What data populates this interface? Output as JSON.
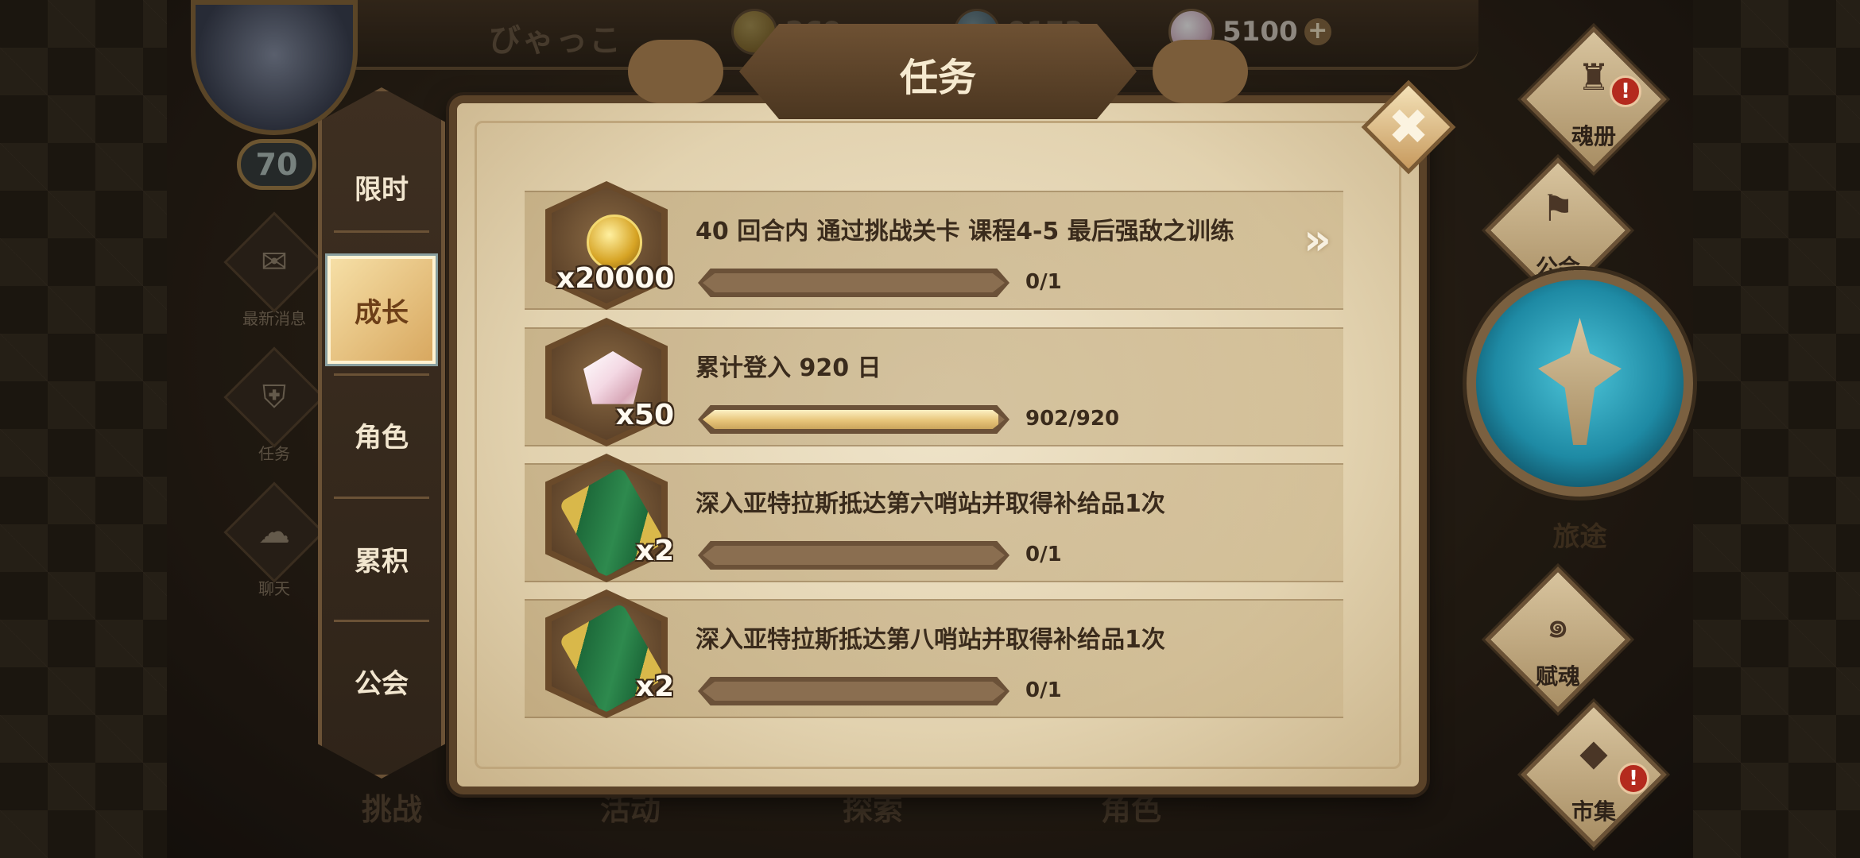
{
  "header": {
    "player_name": "びゃっこ",
    "level": "70",
    "currencies": [
      {
        "name": "gold",
        "value": "269"
      },
      {
        "name": "blue",
        "value": "9173"
      },
      {
        "name": "gem",
        "value": "5100"
      }
    ],
    "add_label": "+"
  },
  "left_menu": [
    {
      "label": "最新消息",
      "icon": "scroll-icon",
      "glyph": "✉"
    },
    {
      "label": "任务",
      "icon": "badge-icon",
      "glyph": "⛨"
    },
    {
      "label": "聊天",
      "icon": "chat-icon",
      "glyph": "☁"
    }
  ],
  "bottom_tabs": [
    "挑战",
    "活动",
    "探索",
    "角色"
  ],
  "panel": {
    "title": "任务",
    "close_label": "✖",
    "tabs": [
      {
        "label": "限时",
        "active": false
      },
      {
        "label": "成长",
        "active": true
      },
      {
        "label": "角色",
        "active": false
      },
      {
        "label": "累积",
        "active": false
      },
      {
        "label": "公会",
        "active": false
      }
    ],
    "quests": [
      {
        "title": "40 回合内   通过挑战关卡 课程4-5 最后强敌之训练",
        "reward_icon": "gold-coin-icon",
        "reward_qty": "x20000",
        "progress_text": "0/1",
        "progress": 0.0
      },
      {
        "title": "累计登入 920 日",
        "reward_icon": "gem-icon",
        "reward_qty": "x50",
        "progress_text": "902/920",
        "progress": 0.98
      },
      {
        "title": "深入亚特拉斯抵达第六哨站并取得补给品1次",
        "reward_icon": "scroll-ticket-icon",
        "reward_qty": "x2",
        "progress_text": "0/1",
        "progress": 0.0
      },
      {
        "title": "深入亚特拉斯抵达第八哨站并取得补给品1次",
        "reward_icon": "scroll-ticket-icon",
        "reward_qty": "x2",
        "progress_text": "0/1",
        "progress": 0.0
      }
    ],
    "go_arrow": "»"
  },
  "right_menu": [
    {
      "label": "魂册",
      "icon": "helmet-icon",
      "glyph": "♜",
      "alert": true
    },
    {
      "label": "公会",
      "icon": "guild-banner-icon",
      "glyph": "⚑",
      "alert": false
    },
    {
      "label": "旅途",
      "icon": "journey-emblem-icon",
      "alert": false
    },
    {
      "label": "赋魂",
      "icon": "spiral-icon",
      "glyph": "๑",
      "alert": false
    },
    {
      "label": "市集",
      "icon": "market-crystal-icon",
      "glyph": "◆",
      "alert": true
    }
  ],
  "alert_glyph": "!",
  "colors": {
    "accent": "#d8a860",
    "panel": "#e2d2af",
    "frame": "#5a4228",
    "alert": "#b42a1e"
  }
}
